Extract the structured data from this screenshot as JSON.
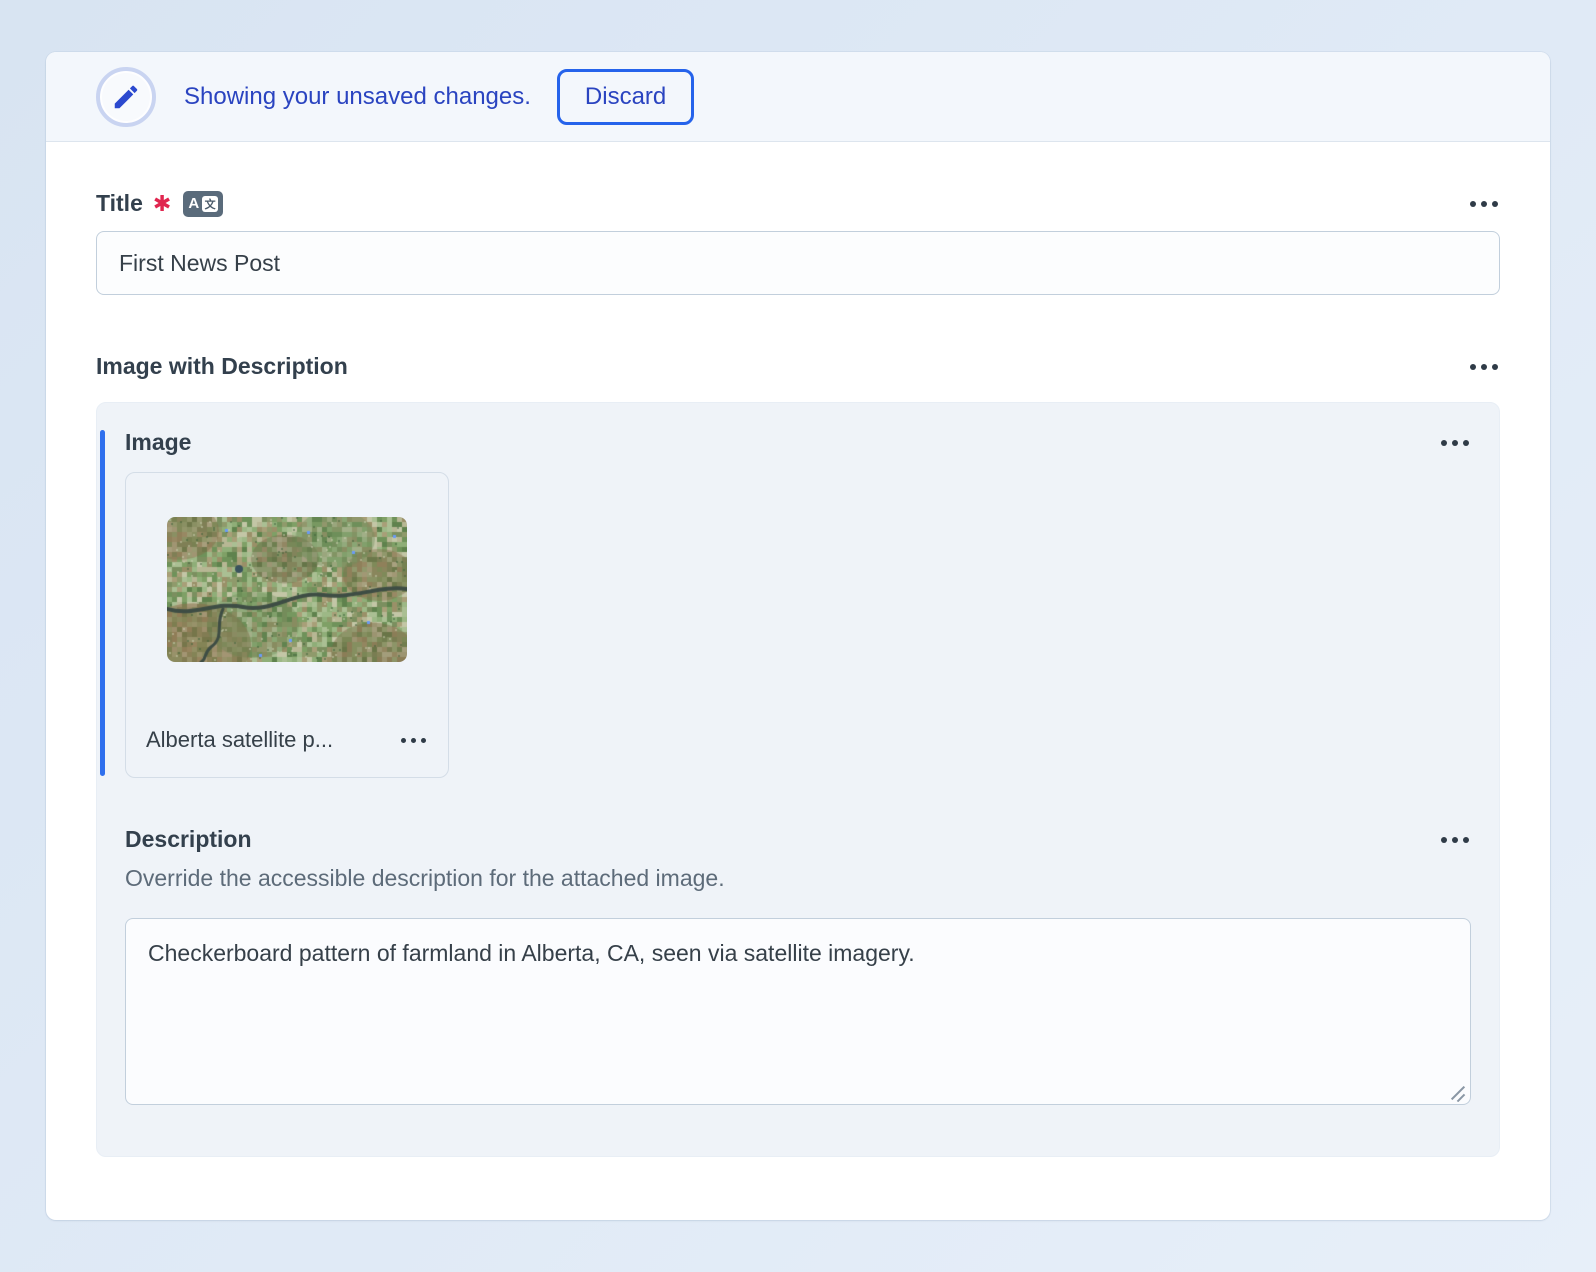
{
  "banner": {
    "message": "Showing your unsaved changes.",
    "discard_label": "Discard"
  },
  "title_field": {
    "label": "Title",
    "required_marker": "✱",
    "value": "First News Post",
    "localized_icon_letter": "A",
    "localized_icon_glyph": "文"
  },
  "section": {
    "label": "Image with Description"
  },
  "image_field": {
    "label": "Image",
    "thumbnail_caption": "Alberta satellite p..."
  },
  "description_field": {
    "label": "Description",
    "help_text": "Override the accessible description for the attached image.",
    "value": "Checkerboard pattern of farmland in Alberta, CA, seen via satellite imagery."
  },
  "icons": {
    "edit_status": "pencil-icon",
    "localization": "translate-icon",
    "row_menus": "ellipsis-icon",
    "thumbnail": "satellite-image"
  },
  "colors": {
    "banner_text": "#2a44c0",
    "discard_border": "#2563eb",
    "required_red": "#e0264f",
    "active_bar_blue": "#2f6fed",
    "pencil_blue": "#2b49cf",
    "label_slate": "#33404d",
    "card_background": "#eff3f8"
  }
}
